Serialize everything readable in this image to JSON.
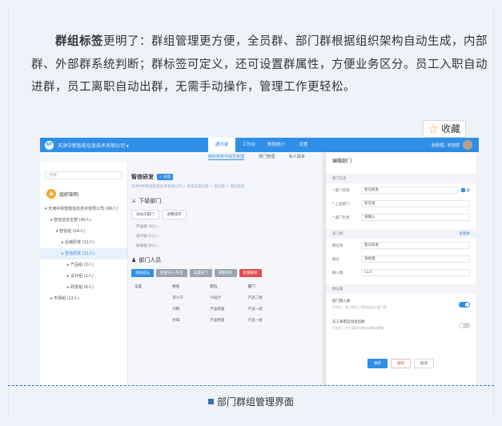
{
  "article": {
    "lead": "群组标签",
    "body": "更明了：群组管理更方便，全员群、部门群根据组织架构自动生成，内部群、外部群系统判断；群标签可定义，还可设置群属性，方便业务区分。员工入职自动进群，员工离职自动出群，无需手动操作，管理工作更轻松。"
  },
  "favorite": {
    "label": "收藏",
    "icon": "star-icon"
  },
  "screenshot": {
    "logo": "NT",
    "company": "天津中新智能信息技术有限公司 ▾",
    "nav": [
      "通讯录",
      "工作台",
      "数据统计",
      "设置"
    ],
    "nav_active": 0,
    "user": "张经理，欢迎您",
    "subnav": [
      "组织架构与成员管理",
      "部门管理",
      "私人联系"
    ],
    "search_placeholder": "搜索",
    "org_title": "组织架构",
    "tree": [
      {
        "label": "▾ 天津中新智能信息技术有限公司 (96人)",
        "indent": 0
      },
      {
        "label": "▾ 智信信息全部 (46人)",
        "indent": 1
      },
      {
        "label": "▾ 智信组 (24人)",
        "indent": 2
      },
      {
        "label": "▸ 后端研发 (11人)",
        "indent": 3
      },
      {
        "label": "▸ 智信研发 (11人)",
        "indent": 3,
        "selected": true
      },
      {
        "label": "▸ 产品组 (3人)",
        "indent": 4
      },
      {
        "label": "▸ 设计组 (2人)",
        "indent": 4
      },
      {
        "label": "▸ 研发组 (6人)",
        "indent": 4
      },
      {
        "label": "▸ 市场组 (22人)",
        "indent": 1
      }
    ],
    "dept_title": "智信研发",
    "dept_tag": "✓ 标签",
    "crumb": "天津中新智能信息技术有限公司 > 智信信息全部 > 智信组 > 智信研发",
    "sub_title": "下级部门",
    "sub_buttons": [
      "添加子部门",
      "调整排序"
    ],
    "sub_items": [
      "产品组 (3人) ›",
      "设计组 (2人) ›",
      "研发组 (6人) ›"
    ],
    "members_title": "部门人员",
    "member_buttons": [
      {
        "label": "添加成员",
        "color": "#2f8fe8"
      },
      {
        "label": "批量导入/导出",
        "color": "#9aa4b1"
      },
      {
        "label": "设置部门",
        "color": "#9aa4b1"
      },
      {
        "label": "调整排序",
        "color": "#9aa4b1"
      },
      {
        "label": "批量删除",
        "color": "#e84b4b"
      }
    ],
    "table_headers": [
      "全选",
      "姓名",
      "职位",
      "部门",
      ""
    ],
    "table_rows": [
      [
        "",
        "李小宁",
        "UI设计",
        "产品二组",
        ""
      ],
      [
        "",
        "刘畅",
        "产品经理",
        "产品一组",
        ""
      ],
      [
        "",
        "孙琪",
        "产品经理",
        "产品一组",
        ""
      ]
    ],
    "panel": {
      "title": "编辑部门",
      "group1": "部门信息",
      "rows": [
        {
          "k": "* 部门名称",
          "v": "智信研发",
          "check": "群"
        },
        {
          "k": "* 上级部门",
          "v": "智信组"
        },
        {
          "k": "* 部门负责",
          "v": "请输入"
        }
      ],
      "group2": "部门群",
      "group2_link": "查看群",
      "rows2": [
        {
          "k": "群名称",
          "v": "智信研发"
        },
        {
          "k": "群主",
          "v": "张经理"
        },
        {
          "k": "群人数",
          "v": "11人"
        }
      ],
      "group3": "群设置",
      "switches": [
        {
          "title": "部门群入群",
          "desc": "开启后，新入职员工将自动加入部门群",
          "on": true
        },
        {
          "title": "员工离职自动退出群",
          "desc": "开启后，员工离职后将自动移出群聊",
          "on": false
        }
      ],
      "buttons": [
        "保存",
        "删除",
        "取消"
      ]
    }
  },
  "caption": "部门群组管理界面"
}
